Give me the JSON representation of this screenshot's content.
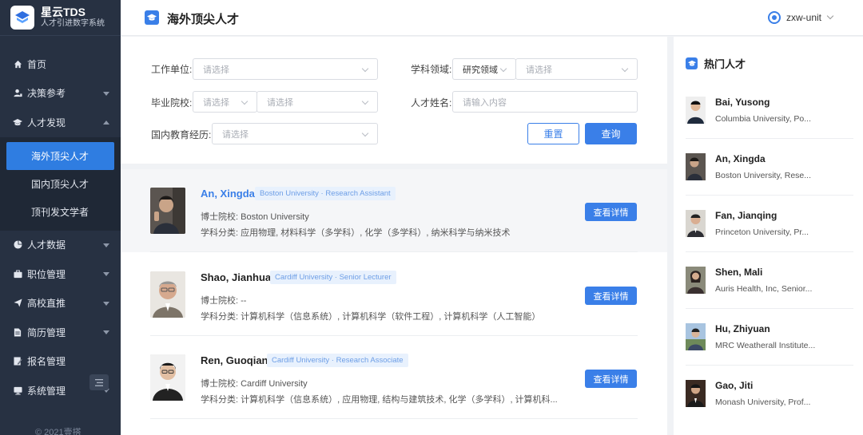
{
  "brand": {
    "name": "星云TDS",
    "subtitle": "人才引进数字系统"
  },
  "sidebar": {
    "items": [
      {
        "label": "首页",
        "icon": "home-icon"
      },
      {
        "label": "决策参考",
        "icon": "user-chart-icon"
      },
      {
        "label": "人才发现",
        "icon": "graduation-cap-icon"
      }
    ],
    "sub_items": [
      {
        "label": "海外顶尖人才",
        "active": true
      },
      {
        "label": "国内顶尖人才"
      },
      {
        "label": "顶刊发文学者"
      }
    ],
    "items_after": [
      {
        "label": "人才数据",
        "icon": "pie-chart-icon"
      },
      {
        "label": "职位管理",
        "icon": "briefcase-icon"
      },
      {
        "label": "高校直推",
        "icon": "send-icon"
      },
      {
        "label": "简历管理",
        "icon": "document-icon"
      },
      {
        "label": "报名管理",
        "icon": "form-icon"
      },
      {
        "label": "系统管理",
        "icon": "monitor-icon"
      }
    ],
    "copyright": "© 2021壹搭"
  },
  "header": {
    "title": "海外顶尖人才",
    "user": "zxw-unit"
  },
  "filter": {
    "work_unit_label": "工作单位:",
    "work_unit_placeholder": "请选择",
    "field_label": "学科领域:",
    "field_type_value": "研究领域",
    "field_placeholder": "请选择",
    "school_label": "毕业院校:",
    "school_placeholder_1": "请选择",
    "school_placeholder_2": "请选择",
    "name_label": "人才姓名:",
    "name_placeholder": "请输入内容",
    "edu_label": "国内教育经历:",
    "edu_placeholder": "请选择",
    "reset_label": "重置",
    "query_label": "查询"
  },
  "results": [
    {
      "name": "An, Xingda",
      "tag": "Boston University · Research Assistant",
      "phd": "博士院校: Boston University",
      "subjects": "学科分类: 应用物理, 材料科学（多学科）, 化学（多学科）, 纳米科学与纳米技术",
      "button": "查看详情"
    },
    {
      "name": "Shao, Jianhua",
      "tag": "Cardiff University · Senior Lecturer",
      "phd": "博士院校: --",
      "subjects": "学科分类: 计算机科学（信息系统）, 计算机科学（软件工程）, 计算机科学（人工智能）",
      "button": "查看详情"
    },
    {
      "name": "Ren, Guoqian",
      "tag": "Cardiff University · Research Associate",
      "phd": "博士院校: Cardiff University",
      "subjects": "学科分类: 计算机科学（信息系统）, 应用物理, 结构与建筑技术, 化学（多学科）, 计算机科...",
      "button": "查看详情"
    }
  ],
  "hot": {
    "title": "热门人才",
    "items": [
      {
        "name": "Bai, Yusong",
        "aff": "Columbia University, Po..."
      },
      {
        "name": "An, Xingda",
        "aff": "Boston University, Rese..."
      },
      {
        "name": "Fan, Jianqing",
        "aff": "Princeton University, Pr..."
      },
      {
        "name": "Shen, Mali",
        "aff": "Auris Health, Inc, Senior..."
      },
      {
        "name": "Hu, Zhiyuan",
        "aff": "MRC Weatherall Institute..."
      },
      {
        "name": "Gao, Jiti",
        "aff": "Monash University, Prof..."
      }
    ]
  },
  "colors": {
    "accent": "#3a7fe8",
    "sidebar": "#273142",
    "tag_bg": "#e8f1fd"
  }
}
